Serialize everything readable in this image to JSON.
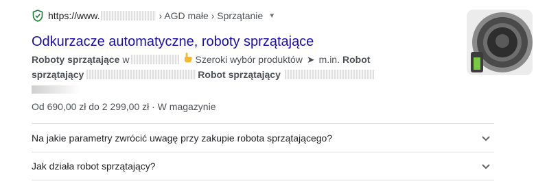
{
  "result": {
    "url": {
      "domain": "https://www.",
      "path": "› AGD małe › Sprzątanie"
    },
    "title": "Odkurzacze automatyczne, roboty sprzątające",
    "snippet": {
      "line1_bold": "Roboty sprzątające",
      "line1_w": "w",
      "line1_text": "Szeroki wybór produktów",
      "line1_arrow": "➤",
      "line1_min": "m.in.",
      "line1_robot": "Robot",
      "line2_bold1": "sprzątający",
      "line2_bold2": "Robot sprzątający"
    },
    "price": "Od 690,00 zł do 2 299,00 zł · W magazynie"
  },
  "faq": [
    {
      "question": "Na jakie parametry zwrócić uwagę przy zakupie robota sprzątającego?"
    },
    {
      "question": "Jak działa robot sprzątający?"
    }
  ],
  "colors": {
    "title": "#1a0dab",
    "snippet": "#4d5156",
    "shield": "#188038"
  }
}
